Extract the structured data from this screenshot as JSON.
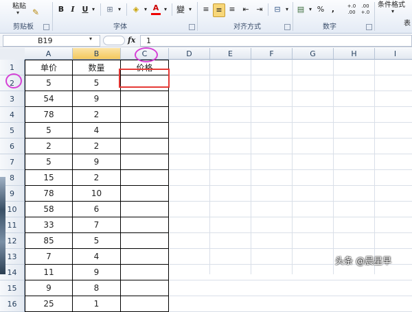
{
  "ribbon": {
    "paste_label": "粘贴",
    "conditional_format_label": "条件格式",
    "style_fragment": "表",
    "toolbar": {
      "bold": "B",
      "italic": "I",
      "underline": "U",
      "font_color": "A",
      "wen": "變",
      "percent": "%",
      "comma": ",",
      "inc_decimal": "+.0 .00",
      "dec_decimal": ".00 +.0"
    },
    "groups": {
      "clipboard": "剪贴板",
      "font": "字体",
      "alignment": "对齐方式",
      "number": "数字"
    }
  },
  "formula_bar": {
    "name_box": "B19",
    "fx_label": "fx",
    "formula": "1"
  },
  "sheet": {
    "columns": [
      "A",
      "B",
      "C",
      "D",
      "E",
      "F",
      "G",
      "H",
      "I"
    ],
    "selected_column": "B",
    "rows": [
      "1",
      "2",
      "3",
      "4",
      "5",
      "6",
      "7",
      "8",
      "9",
      "10",
      "11",
      "12",
      "13",
      "14",
      "15",
      "16"
    ],
    "header": {
      "a": "单价",
      "b": "数量",
      "c": "价格"
    },
    "data": [
      {
        "a": "5",
        "b": "5"
      },
      {
        "a": "54",
        "b": "9"
      },
      {
        "a": "78",
        "b": "2"
      },
      {
        "a": "5",
        "b": "4"
      },
      {
        "a": "2",
        "b": "2"
      },
      {
        "a": "5",
        "b": "9"
      },
      {
        "a": "15",
        "b": "2"
      },
      {
        "a": "78",
        "b": "10"
      },
      {
        "a": "58",
        "b": "6"
      },
      {
        "a": "33",
        "b": "7"
      },
      {
        "a": "85",
        "b": "5"
      },
      {
        "a": "7",
        "b": "4"
      },
      {
        "a": "11",
        "b": "9"
      },
      {
        "a": "9",
        "b": "8"
      },
      {
        "a": "25",
        "b": "1"
      }
    ]
  },
  "annotation_colors": {
    "highlight_box": "#e53935",
    "circle": "#d63fd6"
  },
  "watermark": "头条 @晨星早"
}
